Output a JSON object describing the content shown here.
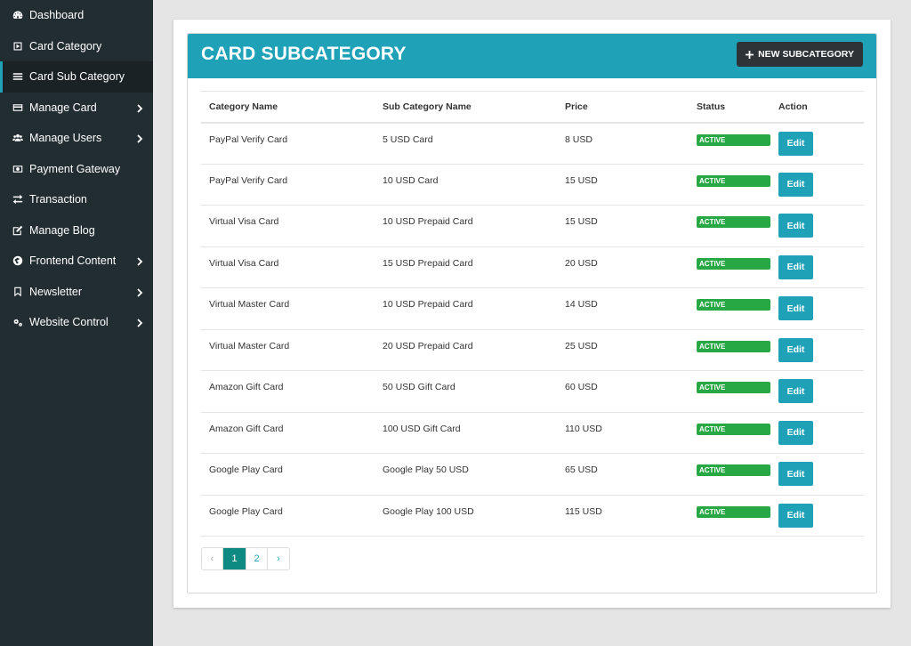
{
  "sidebar": {
    "items": [
      {
        "label": "Dashboard",
        "icon": "dashboard-icon",
        "has_submenu": false,
        "active": false
      },
      {
        "label": "Card Category",
        "icon": "play-square-icon",
        "has_submenu": false,
        "active": false
      },
      {
        "label": "Card Sub Category",
        "icon": "bars-icon",
        "has_submenu": false,
        "active": true
      },
      {
        "label": "Manage Card",
        "icon": "credit-card-icon",
        "has_submenu": true,
        "active": false
      },
      {
        "label": "Manage Users",
        "icon": "users-icon",
        "has_submenu": true,
        "active": false
      },
      {
        "label": "Payment Gateway",
        "icon": "money-icon",
        "has_submenu": false,
        "active": false
      },
      {
        "label": "Transaction",
        "icon": "exchange-icon",
        "has_submenu": false,
        "active": false
      },
      {
        "label": "Manage Blog",
        "icon": "edit-icon",
        "has_submenu": false,
        "active": false
      },
      {
        "label": "Frontend Content",
        "icon": "globe-icon",
        "has_submenu": true,
        "active": false
      },
      {
        "label": "Newsletter",
        "icon": "bookmark-icon",
        "has_submenu": true,
        "active": false
      },
      {
        "label": "Website Control",
        "icon": "cogs-icon",
        "has_submenu": true,
        "active": false
      }
    ]
  },
  "header": {
    "title": "CARD SUBCATEGORY",
    "new_button_label": "NEW SUBCATEGORY"
  },
  "table": {
    "columns": [
      "Category Name",
      "Sub Category Name",
      "Price",
      "Status",
      "Action"
    ],
    "rows": [
      {
        "category": "PayPal Verify Card",
        "subcategory": "5 USD Card",
        "price": "8 USD",
        "status": "ACTIVE",
        "action": "Edit"
      },
      {
        "category": "PayPal Verify Card",
        "subcategory": "10 USD Card",
        "price": "15 USD",
        "status": "ACTIVE",
        "action": "Edit"
      },
      {
        "category": "Virtual Visa Card",
        "subcategory": "10 USD Prepaid Card",
        "price": "15 USD",
        "status": "ACTIVE",
        "action": "Edit"
      },
      {
        "category": "Virtual Visa Card",
        "subcategory": "15 USD Prepaid Card",
        "price": "20 USD",
        "status": "ACTIVE",
        "action": "Edit"
      },
      {
        "category": "Virtual Master Card",
        "subcategory": "10 USD Prepaid Card",
        "price": "14 USD",
        "status": "ACTIVE",
        "action": "Edit"
      },
      {
        "category": "Virtual Master Card",
        "subcategory": "20 USD Prepaid Card",
        "price": "25 USD",
        "status": "ACTIVE",
        "action": "Edit"
      },
      {
        "category": "Amazon Gift Card",
        "subcategory": "50 USD Gift Card",
        "price": "60 USD",
        "status": "ACTIVE",
        "action": "Edit"
      },
      {
        "category": "Amazon Gift Card",
        "subcategory": "100 USD Gift Card",
        "price": "110 USD",
        "status": "ACTIVE",
        "action": "Edit"
      },
      {
        "category": "Google Play Card",
        "subcategory": "Google Play 50 USD",
        "price": "65 USD",
        "status": "ACTIVE",
        "action": "Edit"
      },
      {
        "category": "Google Play Card",
        "subcategory": "Google Play 100 USD",
        "price": "115 USD",
        "status": "ACTIVE",
        "action": "Edit"
      }
    ]
  },
  "pagination": {
    "prev": "‹",
    "pages": [
      "1",
      "2"
    ],
    "current": "1",
    "next": "›"
  },
  "colors": {
    "sidebar_bg": "#222d32",
    "accent": "#1fa2b8",
    "active_badge": "#28a745",
    "page_active": "#0f8a83",
    "dark_button": "#2d3336"
  }
}
